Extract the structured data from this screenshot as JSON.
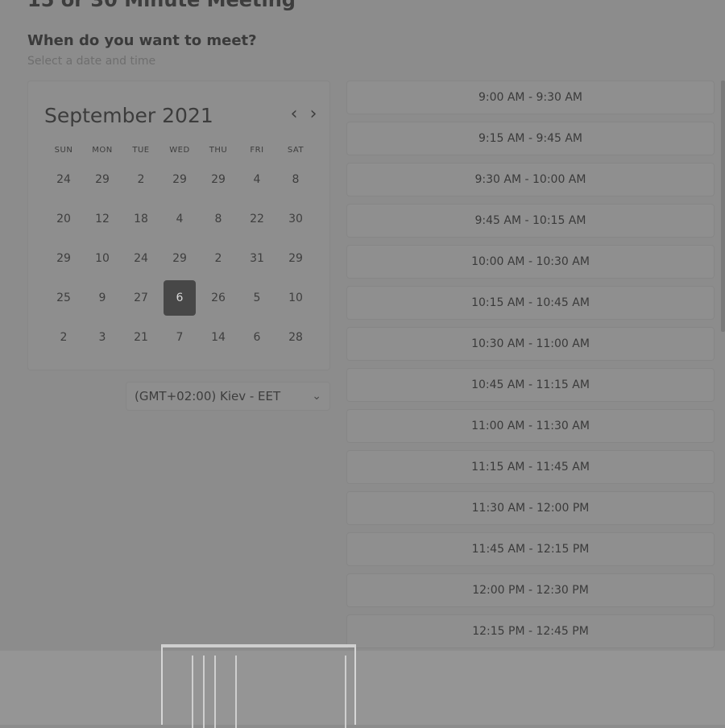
{
  "header": {
    "page_title": "15 or 30 Minute Meeting",
    "heading": "When do you want to meet?",
    "subheading": "Select a date and time"
  },
  "calendar": {
    "month_label": "September 2021",
    "prev_icon": "chevron-left-icon",
    "next_icon": "chevron-right-icon",
    "weekdays": [
      "SUN",
      "MON",
      "TUE",
      "WED",
      "THU",
      "FRI",
      "SAT"
    ],
    "rows": [
      [
        "24",
        "29",
        "2",
        "29",
        "29",
        "4",
        "8"
      ],
      [
        "20",
        "12",
        "18",
        "4",
        "8",
        "22",
        "30"
      ],
      [
        "29",
        "10",
        "24",
        "29",
        "2",
        "31",
        "29"
      ],
      [
        "25",
        "9",
        "27",
        "6",
        "26",
        "5",
        "10"
      ],
      [
        "2",
        "3",
        "21",
        "7",
        "14",
        "6",
        "28"
      ]
    ],
    "selected_day": "6"
  },
  "timezone": {
    "value": "(GMT+02:00) Kiev - EET",
    "icon": "chevron-down-icon"
  },
  "time_slots": [
    "9:00 AM - 9:30 AM",
    "9:15 AM - 9:45 AM",
    "9:30 AM - 10:00 AM",
    "9:45 AM - 10:15 AM",
    "10:00 AM - 10:30 AM",
    "10:15 AM - 10:45 AM",
    "10:30 AM - 11:00 AM",
    "10:45 AM - 11:15 AM",
    "11:00 AM - 11:30 AM",
    "11:15 AM - 11:45 AM",
    "11:30 AM - 12:00 PM",
    "11:45 AM - 12:15 PM",
    "12:00 PM - 12:30 PM",
    "12:15 PM - 12:45 PM"
  ],
  "colors": {
    "background": "#8c8c8c",
    "selected_day": "#474747",
    "text": "#3a3a3a"
  }
}
